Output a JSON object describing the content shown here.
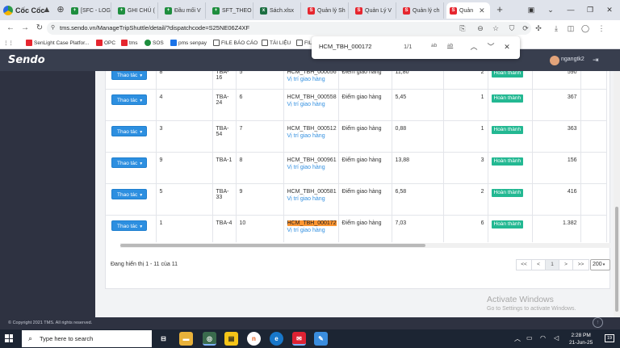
{
  "browser": {
    "brand": "Cốc Cốc",
    "tabs": [
      {
        "label": "[SFC - LOG",
        "icon": "sheet"
      },
      {
        "label": "GHI CHÚ (",
        "icon": "sheet"
      },
      {
        "label": "Đầu mối V",
        "icon": "sheet"
      },
      {
        "label": "SFT_THEO",
        "icon": "sheet"
      },
      {
        "label": "Sách.xlsx",
        "icon": "excel"
      },
      {
        "label": "Quản lý Sh",
        "icon": "sendo"
      },
      {
        "label": "Quản Lý V",
        "icon": "sendo"
      },
      {
        "label": "Quản lý ch",
        "icon": "sendo"
      },
      {
        "label": "Quản",
        "icon": "sendo"
      }
    ],
    "url": "tms.sendo.vn/ManageTripShuttle/detail/?dispatchcode=S25NE06Z4XF",
    "bookmarks": [
      {
        "label": "SenLight Case Platfor...",
        "color": "#e6262f"
      },
      {
        "label": "OPC",
        "color": "#e6262f"
      },
      {
        "label": "tms",
        "color": "#e6262f"
      },
      {
        "label": "SOS",
        "color": "#1e8e3e"
      },
      {
        "label": "pms senpay",
        "color": "#1a73e8"
      },
      {
        "label": "FILE BÁO CÁO",
        "color": "#555555"
      },
      {
        "label": "TÀI LIỆU",
        "color": "#555555"
      },
      {
        "label": "FIL",
        "color": "#555555"
      }
    ]
  },
  "find": {
    "query": "HCM_TBH_000172",
    "count": "1/1",
    "opt_case": "ab",
    "opt_word": "ab"
  },
  "app": {
    "logo": "Sendo",
    "username": "ngangtk2"
  },
  "table": {
    "action_label": "Thao tác",
    "location_label": "Vị trí giao hàng",
    "rows": [
      {
        "stt": "8",
        "vehicle": "TBA-16",
        "seq": "5",
        "code": "HCM_TBH_000056",
        "point": "Điểm giao hàng",
        "weight": "11,80",
        "qty": "2",
        "status": "Hoàn thành",
        "amount": "590"
      },
      {
        "stt": "4",
        "vehicle": "TBA-24",
        "seq": "6",
        "code": "HCM_TBH_000558",
        "point": "Điểm giao hàng",
        "weight": "5,45",
        "qty": "1",
        "status": "Hoàn thành",
        "amount": "367"
      },
      {
        "stt": "3",
        "vehicle": "TBA-54",
        "seq": "7",
        "code": "HCM_TBH_000512",
        "point": "Điểm giao hàng",
        "weight": "0,88",
        "qty": "1",
        "status": "Hoàn thành",
        "amount": "363"
      },
      {
        "stt": "9",
        "vehicle": "TBA-1",
        "seq": "8",
        "code": "HCM_TBH_000961",
        "point": "Điểm giao hàng",
        "weight": "13,88",
        "qty": "3",
        "status": "Hoàn thành",
        "amount": "156"
      },
      {
        "stt": "5",
        "vehicle": "TBA-33",
        "seq": "9",
        "code": "HCM_TBH_000581",
        "point": "Điểm giao hàng",
        "weight": "6,58",
        "qty": "2",
        "status": "Hoàn thành",
        "amount": "416"
      },
      {
        "stt": "1",
        "vehicle": "TBA-4",
        "seq": "10",
        "code": "HCM_TBH_000172",
        "point": "Điểm giao hàng",
        "weight": "7,03",
        "qty": "6",
        "status": "Hoàn thành",
        "amount": "1.382"
      }
    ]
  },
  "pagination": {
    "info": "Đang hiển thị 1 - 11 của 11",
    "first": "<<",
    "prev": "<",
    "current": "1",
    "next": ">",
    "last": ">>",
    "page_size": "200"
  },
  "footer": {
    "copyright": "© Copyright 2021 TMS. All rights reserved."
  },
  "watermark": {
    "title": "Activate Windows",
    "subtitle": "Go to Settings to activate Windows."
  },
  "taskbar": {
    "search_placeholder": "Type here to search",
    "time": "2:28 PM",
    "date": "21-Jun-25",
    "notifications": "19"
  },
  "colors": {
    "header_bg": "#383e4e",
    "sidebar_bg": "#2e3241",
    "action_button": "#2d8fe0",
    "status_badge": "#23b892",
    "find_highlight": "#ff9632",
    "link": "#3390e0"
  }
}
